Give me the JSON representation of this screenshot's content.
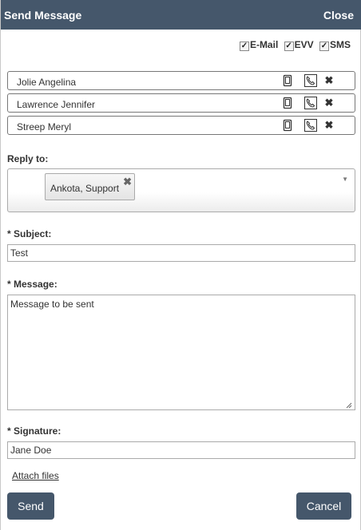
{
  "header": {
    "title": "Send Message",
    "close_label": "Close"
  },
  "channels": [
    {
      "label": "E-Mail",
      "checked": true
    },
    {
      "label": "EVV",
      "checked": true
    },
    {
      "label": "SMS",
      "checked": true
    }
  ],
  "recipients": [
    {
      "name": "Jolie Angelina"
    },
    {
      "name": "Lawrence Jennifer"
    },
    {
      "name": "Streep Meryl"
    }
  ],
  "reply_to": {
    "label": "Reply to:",
    "selected": "Ankota, Support"
  },
  "subject": {
    "label": "* Subject:",
    "value": "Test"
  },
  "message": {
    "label": "* Message:",
    "value": "Message to be sent"
  },
  "signature": {
    "label": "* Signature:",
    "value": "Jane Doe"
  },
  "attach_label": "Attach files",
  "buttons": {
    "send": "Send",
    "cancel": "Cancel"
  },
  "colors": {
    "header_bg": "#45576b",
    "button_bg": "#45576b"
  },
  "icons": {
    "mobile": "mobile-phone-icon",
    "phone": "phone-icon",
    "remove": "close-icon"
  }
}
